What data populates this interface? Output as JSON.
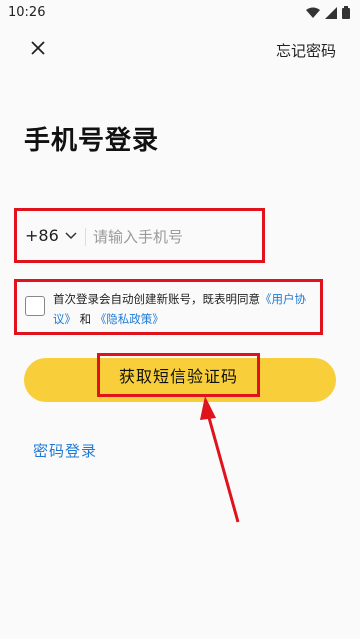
{
  "status_bar": {
    "time": "10:26"
  },
  "header": {
    "forgot_password": "忘记密码"
  },
  "title": "手机号登录",
  "phone": {
    "country_code": "+86",
    "placeholder": "请输入手机号",
    "value": ""
  },
  "agreement": {
    "text_before": "首次登录会自动创建新账号，既表明同意",
    "user_agreement": "《用户协议》",
    "and": " 和 ",
    "privacy_policy": "《隐私政策》"
  },
  "sms_button": {
    "label": "获取短信验证码"
  },
  "password_login": "密码登录",
  "colors": {
    "accent_yellow": "#F8CF3A",
    "link_blue": "#1F7AD6",
    "highlight_red": "#E0131C"
  }
}
